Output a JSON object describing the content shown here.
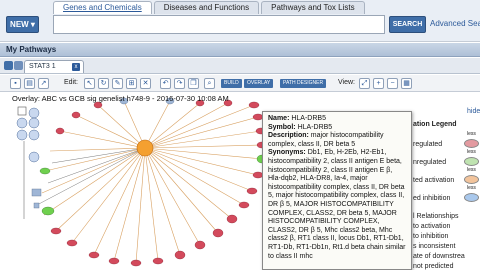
{
  "header": {
    "new_button": "NEW ▾",
    "tabs": [
      "Genes and Chemicals",
      "Diseases and Functions",
      "Pathways and Tox Lists"
    ],
    "search_value": "",
    "search_button": "SEARCH",
    "advanced_link": "Advanced Sea"
  },
  "section": {
    "title": "My Pathways"
  },
  "workspace_tab": {
    "label": "STAT3 1",
    "close": "x"
  },
  "toolbar": {
    "edit_label": "Edit:",
    "build_label": "BUILD",
    "overlay_label": "OVERLAY",
    "path_designer_label": "PATH DESIGNER",
    "view_label": "View:"
  },
  "canvas": {
    "overlay_title": "Overlay: ABC vs GCB sig genelist h748-9 - 2016-07-30 10:08 AM"
  },
  "tooltip": {
    "name_label": "Name:",
    "name_value": "HLA-DRB5",
    "symbol_label": "Symbol:",
    "symbol_value": "HLA-DRB5",
    "description_label": "Description:",
    "description_value": "major histocompatibility complex, class II, DR beta 5",
    "synonyms_label": "Synonyms:",
    "synonyms_value": "Db1, Eb, H-2Eb, H2-Eb1, histocompatibility 2, class II antigen E beta, histocompatibility 2, class II antigen E β, Hla-dqb2, HLA-DR8, Ia-4, major histocompatibility complex, class II, DR beta 5, major histocompatibility complex, class II, DR β 5, MAJOR HISTOCOMPATIBILITY COMPLEX, CLASS2, DR beta 5, MAJOR HISTOCOMPATIBILITY COMPLEX, CLASS2, DR β 5, Mhc class2 beta, Mhc class2 β, RT1 class II, locus Db1, RT1-Db1, RT1-Db, RT1-Db1n, Rt1.d beta chain similar to class II mhc"
  },
  "legend": {
    "hide": "hide",
    "title": "ation Legend",
    "rows": [
      "regulated",
      "nregulated",
      "ted activation",
      "ed inhibition"
    ],
    "less_label": "less",
    "rel_title": "l Relationships",
    "rel_items": [
      "to activation",
      "to inhibition",
      "s inconsistent",
      "ate of downstrea",
      "not predicted"
    ],
    "colors": {
      "up": "#e39aa0",
      "down": "#bfe3b0",
      "activation": "#f2c49c",
      "inhibition": "#a9c8ec"
    }
  }
}
